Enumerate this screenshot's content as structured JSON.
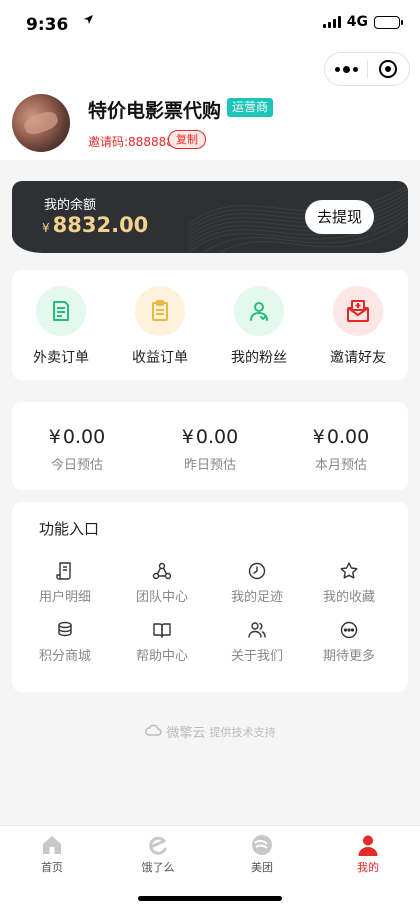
{
  "status_bar": {
    "time": "9:36",
    "network": "4G"
  },
  "profile": {
    "store_name": "特价电影票代购",
    "role_badge": "运营商",
    "invite_code": "邀请码:888888",
    "copy_label": "复制"
  },
  "balance": {
    "label": "我的余额",
    "currency": "¥",
    "amount": "8832.00",
    "withdraw_label": "去提现"
  },
  "orders": [
    {
      "label": "外卖订单",
      "icon": "document-list-icon",
      "bg": "#e4f8ef",
      "color": "#22c07a"
    },
    {
      "label": "收益订单",
      "icon": "clipboard-icon",
      "bg": "#fdf2dc",
      "color": "#f0b441"
    },
    {
      "label": "我的粉丝",
      "icon": "fans-user-icon",
      "bg": "#e4f8ef",
      "color": "#22c07a"
    },
    {
      "label": "邀请好友",
      "icon": "invite-envelope-icon",
      "bg": "#fde6e6",
      "color": "#e22a2a"
    }
  ],
  "estimates": [
    {
      "currency": "¥",
      "value": "0.00",
      "label": "今日预估"
    },
    {
      "currency": "¥",
      "value": "0.00",
      "label": "昨日预估"
    },
    {
      "currency": "¥",
      "value": "0.00",
      "label": "本月预估"
    }
  ],
  "functions": {
    "title": "功能入口",
    "items": [
      {
        "label": "用户明细",
        "icon": "scroll-icon"
      },
      {
        "label": "团队中心",
        "icon": "team-icon"
      },
      {
        "label": "我的足迹",
        "icon": "clock-icon"
      },
      {
        "label": "我的收藏",
        "icon": "star-icon"
      },
      {
        "label": "积分商城",
        "icon": "coins-icon"
      },
      {
        "label": "帮助中心",
        "icon": "book-icon"
      },
      {
        "label": "关于我们",
        "icon": "users-icon"
      },
      {
        "label": "期待更多",
        "icon": "more-icon"
      }
    ]
  },
  "footer": {
    "brand": "微擎云",
    "text": "提供技术支持"
  },
  "tabs": [
    {
      "label": "首页",
      "icon": "home-icon"
    },
    {
      "label": "饿了么",
      "icon": "eleme-icon"
    },
    {
      "label": "美团",
      "icon": "meituan-icon"
    },
    {
      "label": "我的",
      "icon": "profile-icon",
      "active": true
    }
  ],
  "colors": {
    "accent": "#e22a2a",
    "teal": "#1cc6b7",
    "gold": "#f4d28d",
    "card_dark": "#2e3033"
  }
}
